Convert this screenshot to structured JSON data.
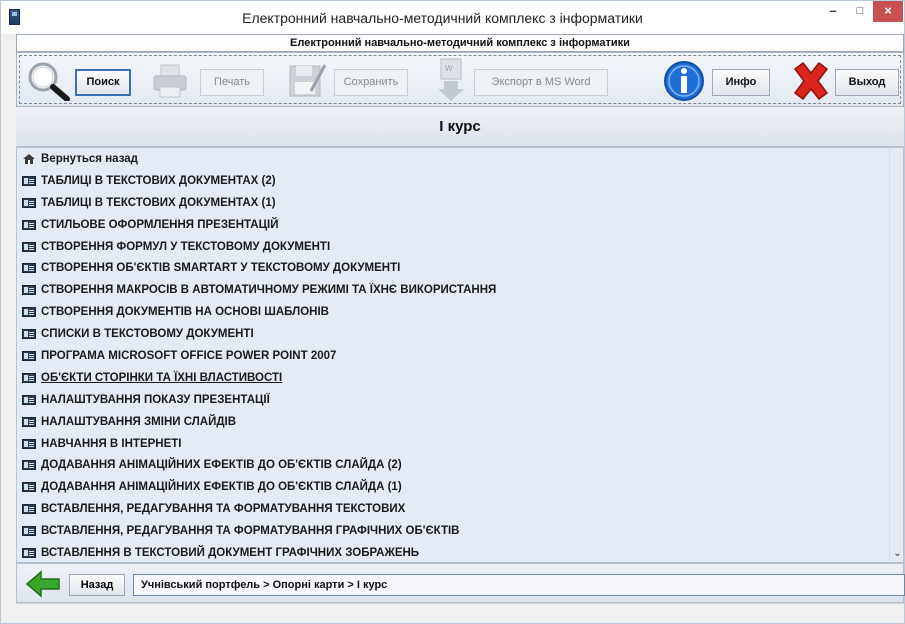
{
  "window": {
    "title": "Електронний навчально-методичний комплекс з інформатики",
    "minimize": "–",
    "maximize": "□",
    "close": "×"
  },
  "subtitle": "Електронний навчально-методичний комплекс з інформатики",
  "toolbar": {
    "search_label": "Поиск",
    "print_label": "Печать",
    "save_label": "Сохранить",
    "export_label": "Экспорт в MS Word",
    "info_label": "Инфо",
    "exit_label": "Выход"
  },
  "section_title": "I курс",
  "list": {
    "back_label": "Вернуться назад",
    "items": [
      "ТАБЛИЦІ В ТЕКСТОВИХ ДОКУМЕНТАХ (2)",
      "ТАБЛИЦІ В ТЕКСТОВИХ ДОКУМЕНТАХ (1)",
      "СТИЛЬОВЕ ОФОРМЛЕННЯ ПРЕЗЕНТАЦІЙ",
      "СТВОРЕННЯ ФОРМУЛ У ТЕКСТОВОМУ ДОКУМЕНТІ",
      "СТВОРЕННЯ ОБ'ЄКТІВ SMARTART У ТЕКСТОВОМУ ДОКУМЕНТІ",
      "СТВОРЕННЯ МАКРОСІВ В АВТОМАТИЧНОМУ РЕЖИМІ ТА ЇХНЄ ВИКОРИСТАННЯ",
      "СТВОРЕННЯ ДОКУМЕНТІВ НА ОСНОВІ ШАБЛОНІВ",
      "СПИСКИ В ТЕКСТОВОМУ ДОКУМЕНТІ",
      "ПРОГРАМА MICROSOFT OFFICE POWER POINT 2007",
      "ОБ'ЄКТИ СТОРІНКИ ТА ЇХНІ ВЛАСТИВОСТІ",
      "НАЛАШТУВАННЯ ПОКАЗУ ПРЕЗЕНТАЦІЇ",
      "НАЛАШТУВАННЯ ЗМІНИ СЛАЙДІВ",
      "НАВЧАННЯ В ІНТЕРНЕТІ",
      "ДОДАВАННЯ АНІМАЦІЙНИХ ЕФЕКТІВ ДО ОБ'ЄКТІВ СЛАЙДА (2)",
      "ДОДАВАННЯ АНІМАЦІЙНИХ ЕФЕКТІВ ДО ОБ'ЄКТІВ СЛАЙДА (1)",
      "ВСТАВЛЕННЯ, РЕДАГУВАННЯ ТА ФОРМАТУВАННЯ ТЕКСТОВИХ",
      "ВСТАВЛЕННЯ, РЕДАГУВАННЯ ТА ФОРМАТУВАННЯ ГРАФІЧНИХ ОБ'ЄКТІВ",
      "ВСТАВЛЕННЯ В ТЕКСТОВИЙ ДОКУМЕНТ ГРАФІЧНИХ ЗОБРАЖЕНЬ"
    ],
    "underlined_index": 9,
    "scroll_down": "⌄"
  },
  "bottom": {
    "back_label": "Назад",
    "breadcrumb": "Учнівський портфель > Опорні карти > I курс"
  },
  "colors": {
    "list_bg": "#e4ebf5",
    "close_red": "#c75050",
    "info_blue": "#1f6fd6",
    "exit_red": "#d9251c",
    "back_green": "#3aa62a"
  }
}
